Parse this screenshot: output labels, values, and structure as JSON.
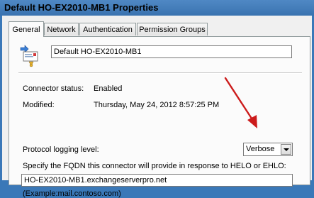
{
  "window": {
    "title": "Default HO-EX2010-MB1 Properties"
  },
  "tabs": [
    {
      "label": "General",
      "active": true
    },
    {
      "label": "Network",
      "active": false
    },
    {
      "label": "Authentication",
      "active": false
    },
    {
      "label": "Permission Groups",
      "active": false
    }
  ],
  "general": {
    "connector_name": "Default HO-EX2010-MB1",
    "connector_status_label": "Connector status:",
    "connector_status_value": "Enabled",
    "modified_label": "Modified:",
    "modified_value": "Thursday, May 24, 2012 8:57:25 PM",
    "protocol_logging_label": "Protocol logging level:",
    "protocol_logging_value": "Verbose",
    "fqdn_label": "Specify the FQDN this connector will provide in response to HELO or EHLO:",
    "fqdn_value": "HO-EX2010-MB1.exchangeserverpro.net",
    "example_text": "(Example:mail.contoso.com)"
  },
  "colors": {
    "annotation_arrow": "#cc1b1b",
    "title_bar": "#3a73b0"
  },
  "icons": [
    "receive-connector-icon",
    "dropdown-arrow-icon",
    "annotation-arrow"
  ]
}
